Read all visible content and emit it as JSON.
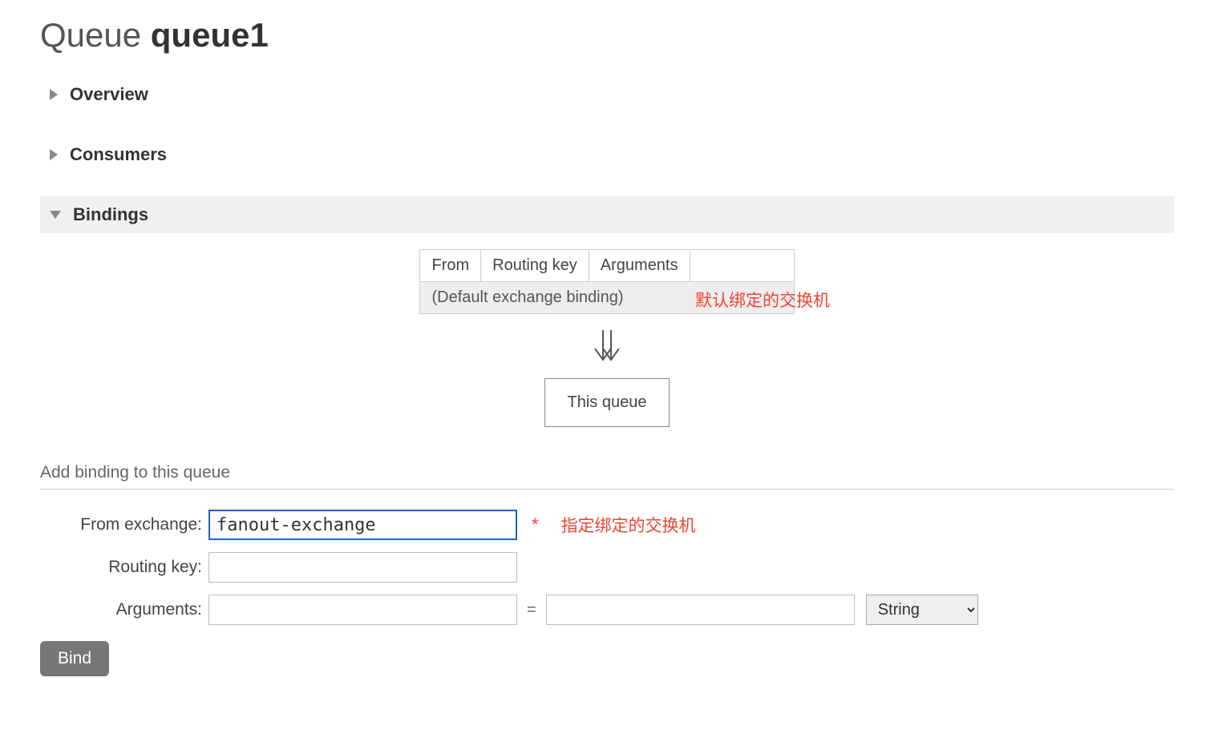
{
  "page": {
    "title_prefix": "Queue ",
    "queue_name": "queue1"
  },
  "sections": {
    "overview": "Overview",
    "consumers": "Consumers",
    "bindings": "Bindings"
  },
  "bindings": {
    "table_headers": {
      "from": "From",
      "routing_key": "Routing key",
      "arguments": "Arguments"
    },
    "default_row": "(Default exchange binding)",
    "annotation": "默认绑定的交换机",
    "this_queue": "This queue"
  },
  "add_binding": {
    "title": "Add binding to this queue",
    "from_label": "From exchange:",
    "from_value": "fanout-exchange",
    "routing_label": "Routing key:",
    "routing_value": "",
    "arguments_label": "Arguments:",
    "arg_key": "",
    "arg_value": "",
    "type_selected": "String",
    "asterisk": "*",
    "annotation": "指定绑定的交换机",
    "bind_button": "Bind"
  }
}
